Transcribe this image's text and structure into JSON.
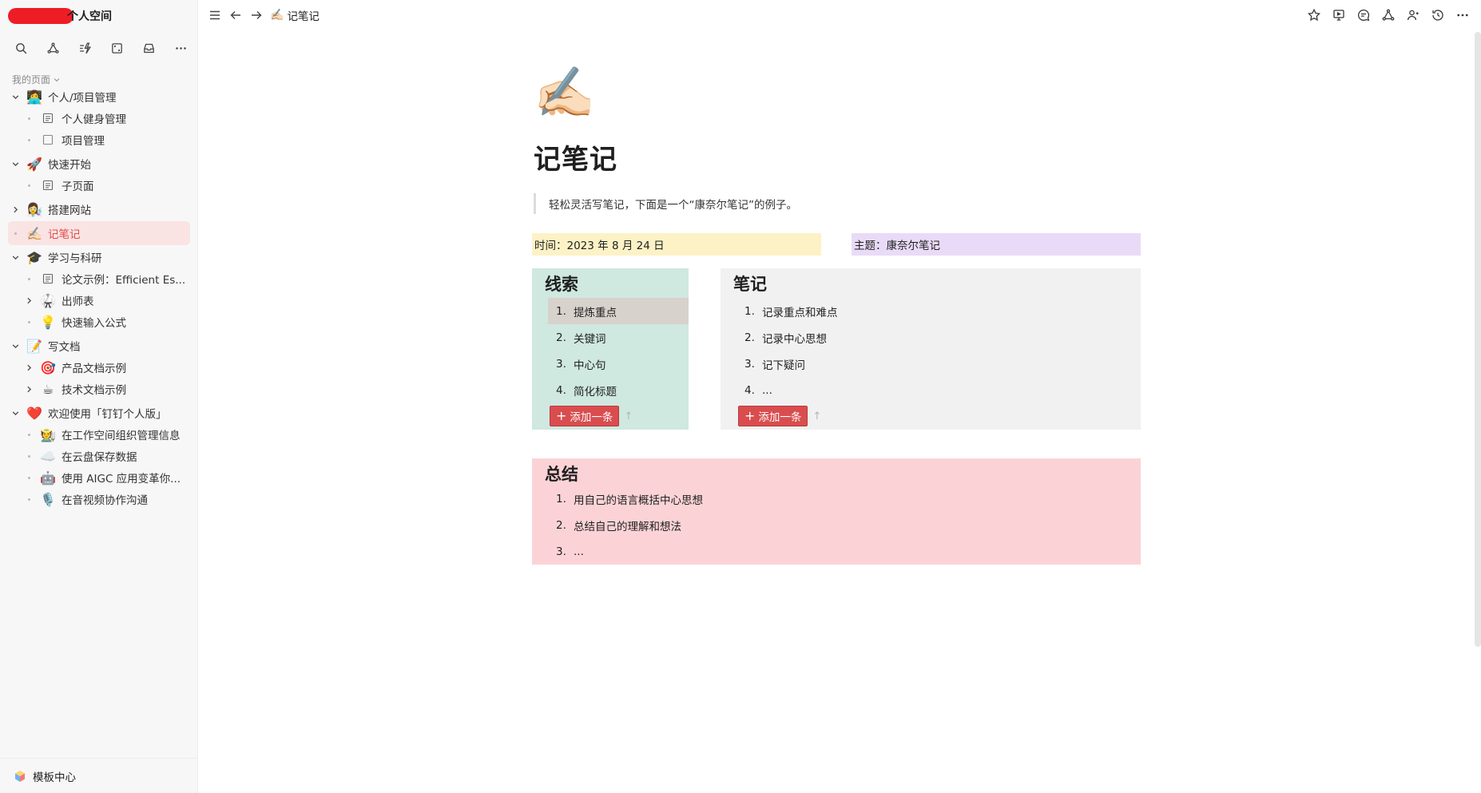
{
  "workspace": {
    "name": "个人空间"
  },
  "sidebar": {
    "section_label": "我的页面",
    "items": [
      {
        "label": "个人/项目管理",
        "icon": "person-at-desk-icon",
        "emoji": "👩‍💻",
        "toggle": "expanded",
        "level": 0
      },
      {
        "label": "个人健身管理",
        "icon": "document-icon",
        "toggle": "dot",
        "level": 1
      },
      {
        "label": "项目管理",
        "icon": "blank-page-icon",
        "toggle": "dot",
        "level": 1
      },
      {
        "label": "快速开始",
        "icon": "rocket-icon",
        "emoji": "🚀",
        "toggle": "expanded",
        "level": 0
      },
      {
        "label": "子页面",
        "icon": "document-icon",
        "toggle": "dot",
        "level": 1
      },
      {
        "label": "搭建网站",
        "icon": "technologist-icon",
        "emoji": "👩‍🔬",
        "toggle": "collapsed",
        "level": 0
      },
      {
        "label": "记笔记",
        "icon": "writing-hand-icon",
        "emoji": "✍🏻",
        "toggle": "dot",
        "level": 0,
        "active": true
      },
      {
        "label": "学习与科研",
        "icon": "graduation-cap-icon",
        "emoji": "🎓",
        "toggle": "expanded",
        "level": 0
      },
      {
        "label": "论文示例：Efficient Es...",
        "icon": "document-icon",
        "toggle": "dot",
        "level": 1
      },
      {
        "label": "出师表",
        "icon": "martial-arts-icon",
        "emoji": "🥋",
        "toggle": "collapsed",
        "level": 1
      },
      {
        "label": "快速输入公式",
        "icon": "light-bulb-icon",
        "emoji": "💡",
        "toggle": "dot",
        "level": 1
      },
      {
        "label": "写文档",
        "icon": "memo-icon",
        "emoji": "📝",
        "toggle": "expanded",
        "level": 0
      },
      {
        "label": "产品文档示例",
        "icon": "target-icon",
        "emoji": "🎯",
        "toggle": "collapsed",
        "level": 1
      },
      {
        "label": "技术文档示例",
        "icon": "coffee-icon",
        "emoji": "☕",
        "toggle": "collapsed",
        "level": 1
      },
      {
        "label": "欢迎使用「钉钉个人版」",
        "icon": "heart-icon",
        "emoji": "❤️",
        "toggle": "expanded",
        "level": 0
      },
      {
        "label": "在工作空间组织管理信息",
        "icon": "person-icon",
        "emoji": "🧑‍🌾",
        "toggle": "dot",
        "level": 1
      },
      {
        "label": "在云盘保存数据",
        "icon": "cloud-icon",
        "emoji": "☁️",
        "toggle": "dot",
        "level": 1
      },
      {
        "label": "使用 AIGC 应用变革你...",
        "icon": "robot-icon",
        "emoji": "🤖",
        "toggle": "dot",
        "level": 1
      },
      {
        "label": "在音视频协作沟通",
        "icon": "microphone-icon",
        "emoji": "🎙️",
        "toggle": "dot",
        "level": 1
      }
    ],
    "footer_label": "模板中心"
  },
  "topbar": {
    "breadcrumb": "记笔记",
    "right_icons": [
      "star-icon",
      "present-icon",
      "comment-icon",
      "share-icon",
      "user-icon",
      "history-icon",
      "more-icon"
    ]
  },
  "doc": {
    "icon_emoji": "✍🏻",
    "title": "记笔记",
    "quote": "轻松灵活写笔记，下面是一个“康奈尔笔记”的例子。",
    "time_label": "时间：2023 年 8 月 24 日",
    "topic_label": "主题：康奈尔笔记",
    "clues": {
      "title": "线索",
      "items": [
        "提炼重点",
        "关键词",
        "中心句",
        "简化标题"
      ],
      "add_label": "添加一条"
    },
    "notes": {
      "title": "笔记",
      "items": [
        "记录重点和难点",
        "记录中心思想",
        "记下疑问",
        "..."
      ],
      "add_label": "添加一条"
    },
    "summary": {
      "title": "总结",
      "items": [
        "用自己的语言概括中心思想",
        "总结自己的理解和想法",
        "..."
      ]
    }
  },
  "colors": {
    "active_bg": "#fae3e3",
    "active_text": "#e24b4b",
    "time_bg": "#fdf2c6",
    "topic_bg": "#e9dbf7",
    "clue_bg": "#cfe8e0",
    "note_bg": "#f1f1f1",
    "summary_bg": "#fbd3d6",
    "add_btn": "#d94d4f"
  }
}
